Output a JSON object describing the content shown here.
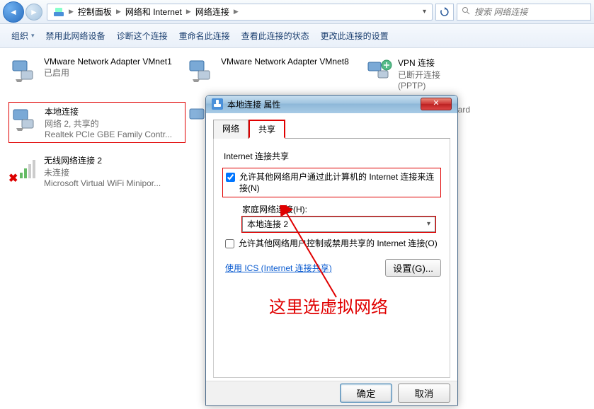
{
  "nav": {
    "crumb1": "控制面板",
    "crumb2": "网络和 Internet",
    "crumb3": "网络连接",
    "search_placeholder": "搜索 网络连接"
  },
  "toolbar": {
    "organize": "组织",
    "disable": "禁用此网络设备",
    "diagnose": "诊断这个连接",
    "rename": "重命名此连接",
    "status": "查看此连接的状态",
    "change": "更改此连接的设置"
  },
  "items": [
    {
      "title": "VMware Network Adapter VMnet1",
      "line2": "已启用",
      "line3": ""
    },
    {
      "title": "VMware Network Adapter VMnet8",
      "line2": "",
      "line3": ""
    },
    {
      "title": "VPN 连接",
      "line2": "已断开连接",
      "line3": "(PPTP)"
    },
    {
      "title": "本地连接",
      "line2": "网络  2, 共享的",
      "line3": "Realtek PCIe GBE Family Contr..."
    },
    {
      "title": "无线网络连接 2",
      "line2": "未连接",
      "line3": "Microsoft Virtual WiFi Minipor..."
    },
    {
      "title": "",
      "line2": "",
      "line3": "Wireless LAN Card"
    }
  ],
  "dialog": {
    "title": "本地连接 属性",
    "tabs": {
      "net": "网络",
      "share": "共享"
    },
    "group": "Internet 连接共享",
    "chk1": "允许其他网络用户通过此计算机的 Internet 连接来连接(N)",
    "home_label": "家庭网络连接(H):",
    "home_value": "本地连接 2",
    "chk2": "允许其他网络用户控制或禁用共享的 Internet 连接(O)",
    "ics_link": "使用 ICS (Internet 连接共享)",
    "settings": "设置(G)...",
    "ok": "确定",
    "cancel": "取消"
  },
  "annotation": "这里选虚拟网络"
}
